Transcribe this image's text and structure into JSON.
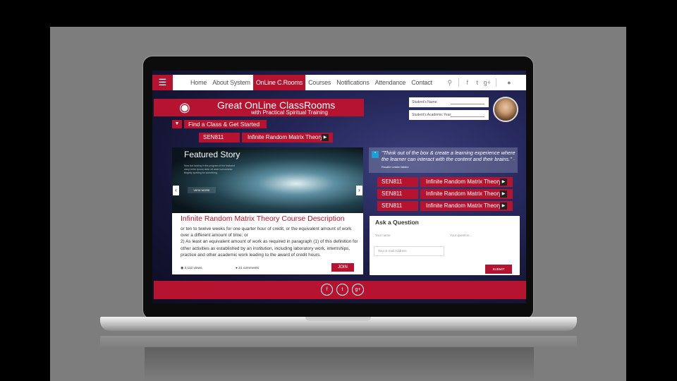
{
  "nav": {
    "menu_icon": "hamburger-icon",
    "items": [
      "Home",
      "About System",
      "OnLine C.Rooms",
      "Courses",
      "Notifications",
      "Attendance",
      "Contact"
    ],
    "active_index": 2,
    "search_icon": "search-icon",
    "social_icons": [
      "f",
      "t",
      "g+"
    ],
    "user_icon": "user-icon"
  },
  "hero": {
    "icon": "eye-icon",
    "title": "Great OnLine ClassRooms",
    "subtitle": "with Practical Spiritual Training"
  },
  "find": {
    "label": "Find a Class & Get Started",
    "code": "SEN811",
    "course": "Infinite Random Matrix Theory"
  },
  "student": {
    "name_label": "Student's Name:",
    "year_label": "Student's Academic Year:"
  },
  "featured": {
    "title": "Featured Story",
    "text": "Now but looking in the program of the featured story lorem ipsum dolor sit amet consectetur. Brightly spelling for something.",
    "button": "VIEW MORE"
  },
  "description": {
    "title": "Infinite Random Matrix Theory Course Description",
    "line1": "or ten to twelve weeks for one quarter hour of credit, or the equivalent amount of work over a different amount of time; or",
    "line2": "2)   As least an equivalent amount of work as required in paragraph (1) of this definition for other activities as established by an institution, including laboratory work, internships, practice and other academic work leading to the award of credit hours.",
    "views": "3,112 views",
    "comments": "21 comments",
    "join": "JOIN"
  },
  "quote": {
    "text": "\"Think out of the box & create a learning experience where the learner can interact with the content and their brains.\"",
    "author": "~ Rosalie Ledda Valdez"
  },
  "course_rows": [
    {
      "code": "SEN811",
      "course": "Infinite Random Matrix Theory"
    },
    {
      "code": "SEN811",
      "course": "Infinite Random Matrix Theory"
    },
    {
      "code": "SEN811",
      "course": "Infinite Random Matrix Theory"
    }
  ],
  "ask": {
    "title": "Ask a Question",
    "name_placeholder": "Your name",
    "question_placeholder": "Your question...",
    "email_placeholder": "Your E-mail Address",
    "submit": "SUBMIT"
  },
  "footer": {
    "icons": [
      "f",
      "t",
      "g+"
    ]
  },
  "colors": {
    "accent": "#b5132f",
    "quote_badge": "#1f9ed6"
  }
}
